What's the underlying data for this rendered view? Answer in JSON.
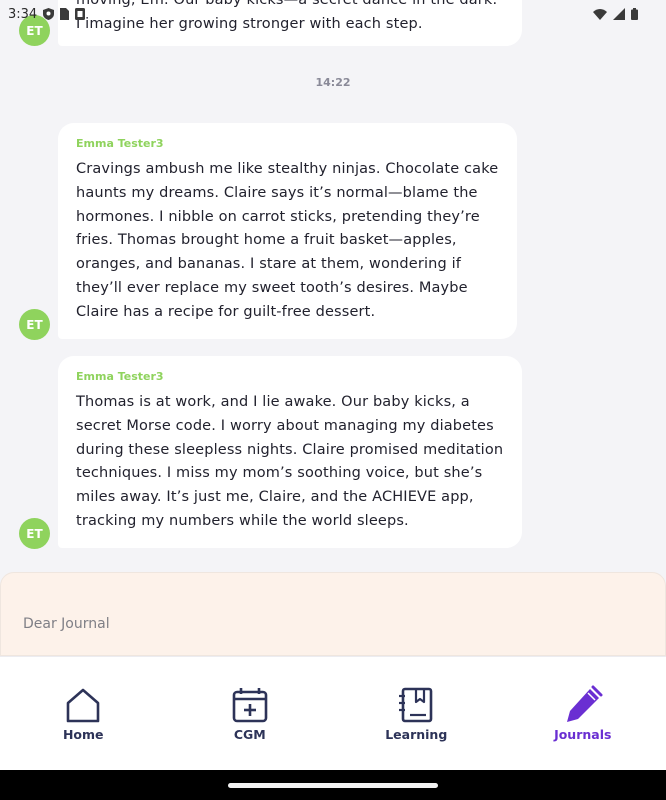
{
  "status_bar": {
    "time": "3:34",
    "icons": [
      "shield-icon",
      "sim-card-icon",
      "notification-icon",
      "wifi-icon",
      "signal-icon",
      "battery-icon"
    ]
  },
  "chat": {
    "partial_message": {
      "line1": "moving, Em. Our baby kicks—a secret dance in the dark.",
      "line2": "I imagine her growing stronger with each step.",
      "avatar_initials": "ET"
    },
    "time_divider": "14:22",
    "messages": [
      {
        "author": "Emma Tester3",
        "avatar_initials": "ET",
        "text": "Cravings ambush me like stealthy ninjas. Chocolate cake haunts my dreams. Claire says it’s normal—blame the hormones. I nibble on carrot sticks, pretending they’re fries. Thomas brought home a fruit basket—apples, oranges, and bananas. I stare at them, wondering if they’ll ever replace my sweet tooth’s desires. Maybe Claire has a recipe for guilt-free dessert."
      },
      {
        "author": "Emma Tester3",
        "avatar_initials": "ET",
        "text": "Thomas is at work, and I lie awake. Our baby kicks, a secret Morse code. I worry about managing my diabetes during these sleepless nights. Claire promised meditation techniques. I miss my mom’s soothing voice, but she’s miles away. It’s just me, Claire, and the ACHIEVE app, tracking my numbers while the world sleeps."
      }
    ]
  },
  "composer": {
    "placeholder": "Dear Journal",
    "value": ""
  },
  "bottom_nav": {
    "items": [
      {
        "label": "Home",
        "icon": "home-icon",
        "active": false
      },
      {
        "label": "CGM",
        "icon": "calendar-plus-icon",
        "active": false
      },
      {
        "label": "Learning",
        "icon": "book-icon",
        "active": false
      },
      {
        "label": "Journals",
        "icon": "pen-icon",
        "active": true
      }
    ]
  },
  "colors": {
    "background": "#f4f4f7",
    "bubble": "#ffffff",
    "avatar": "#8fd35d",
    "author": "#8fd35d",
    "composer_bg": "#fdf2ea",
    "nav_inactive": "#2d3358",
    "nav_active": "#6a2fd2"
  }
}
